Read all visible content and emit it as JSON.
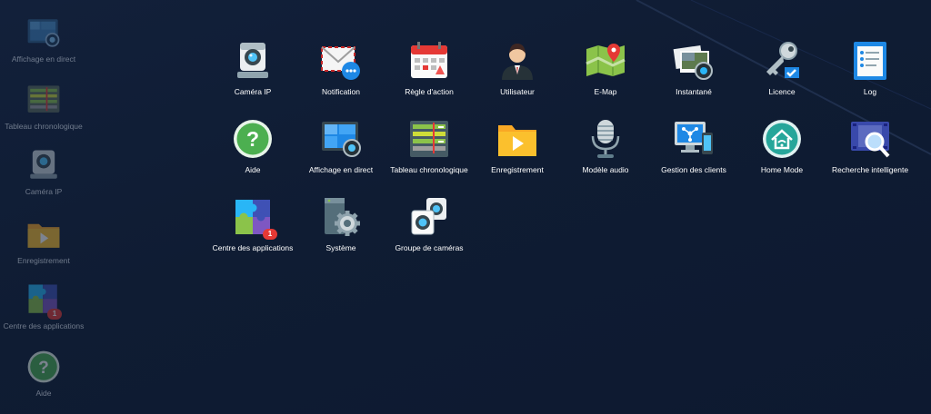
{
  "desktop": {
    "shortcuts": [
      {
        "label": "Affichage en direct",
        "icon": "live-view-icon"
      },
      {
        "label": "Tableau chronologique",
        "icon": "timeline-icon"
      },
      {
        "label": "Caméra IP",
        "icon": "ip-camera-icon"
      },
      {
        "label": "Enregistrement",
        "icon": "recording-folder-icon"
      },
      {
        "label": "Centre des applications",
        "icon": "puzzle-icon",
        "badge": "1"
      },
      {
        "label": "Aide",
        "icon": "help-icon"
      }
    ]
  },
  "launcher": {
    "apps": [
      {
        "label": "Caméra IP",
        "icon": "ip-camera-icon"
      },
      {
        "label": "Notification",
        "icon": "envelope-chat-icon"
      },
      {
        "label": "Règle d'action",
        "icon": "calendar-rule-icon"
      },
      {
        "label": "Utilisateur",
        "icon": "user-icon"
      },
      {
        "label": "E-Map",
        "icon": "map-pin-icon"
      },
      {
        "label": "Instantané",
        "icon": "snapshot-icon"
      },
      {
        "label": "Licence",
        "icon": "key-icon"
      },
      {
        "label": "Log",
        "icon": "log-clipboard-icon"
      },
      {
        "label": "Aide",
        "icon": "help-icon"
      },
      {
        "label": "Affichage en direct",
        "icon": "live-view-icon"
      },
      {
        "label": "Tableau chronologique",
        "icon": "timeline-icon"
      },
      {
        "label": "Enregistrement",
        "icon": "recording-folder-icon"
      },
      {
        "label": "Modèle audio",
        "icon": "microphone-icon"
      },
      {
        "label": "Gestion des clients",
        "icon": "client-management-icon"
      },
      {
        "label": "Home Mode",
        "icon": "home-mode-icon"
      },
      {
        "label": "Recherche intelligente",
        "icon": "smart-search-icon"
      },
      {
        "label": "Centre des applications",
        "icon": "puzzle-icon",
        "badge": "1"
      },
      {
        "label": "Système",
        "icon": "system-gear-icon"
      },
      {
        "label": "Groupe de caméras",
        "icon": "camera-group-icon"
      }
    ]
  },
  "colors": {
    "background": "#0f1c33",
    "badge": "#e53935",
    "help": "#4caf50",
    "home_mode": "#26a69a"
  }
}
